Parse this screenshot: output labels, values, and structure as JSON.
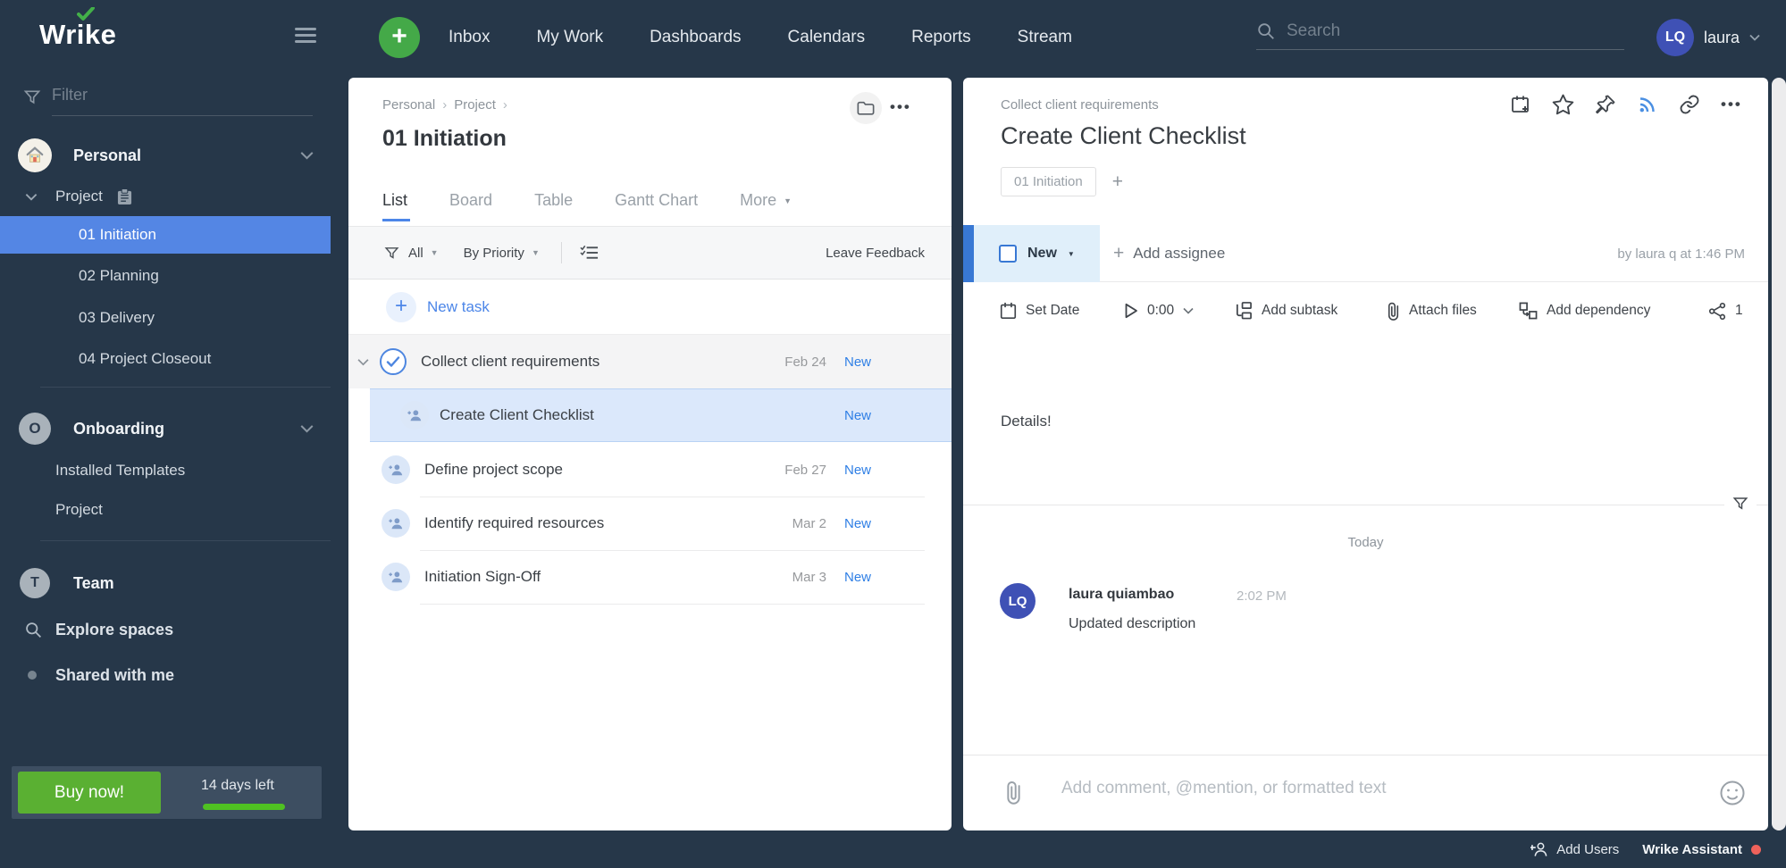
{
  "topbar": {
    "logo": "Wrike",
    "nav_items": [
      "Inbox",
      "My Work",
      "Dashboards",
      "Calendars",
      "Reports",
      "Stream"
    ],
    "search_placeholder": "Search",
    "user": {
      "initials": "LQ",
      "name": "laura"
    }
  },
  "sidebar": {
    "filter_placeholder": "Filter",
    "personal": {
      "label": "Personal"
    },
    "project_group": {
      "label": "Project",
      "items": [
        "01 Initiation",
        "02 Planning",
        "03 Delivery",
        "04 Project Closeout"
      ]
    },
    "onboarding": {
      "label": "Onboarding",
      "items": [
        "Installed Templates",
        "Project"
      ]
    },
    "team": {
      "label": "Team"
    },
    "explore": {
      "label": "Explore spaces"
    },
    "shared": {
      "label": "Shared with me"
    },
    "trial": {
      "buy_label": "Buy now!",
      "days_left": "14 days left"
    }
  },
  "list_panel": {
    "breadcrumb": {
      "first": "Personal",
      "second": "Project"
    },
    "title": "01 Initiation",
    "tabs": [
      "List",
      "Board",
      "Table",
      "Gantt Chart",
      "More"
    ],
    "filter_bar": {
      "scope": "All",
      "sort": "By Priority",
      "feedback_link": "Leave Feedback"
    },
    "new_task_label": "New task",
    "tasks": [
      {
        "title": "Collect client requirements",
        "date": "Feb 24",
        "status": "New"
      },
      {
        "title": "Create Client Checklist",
        "date": "",
        "status": "New"
      },
      {
        "title": "Define project scope",
        "date": "Feb 27",
        "status": "New"
      },
      {
        "title": "Identify required resources",
        "date": "Mar 2",
        "status": "New"
      },
      {
        "title": "Initiation Sign-Off",
        "date": "Mar 3",
        "status": "New"
      }
    ]
  },
  "task_panel": {
    "parent_task": "Collect client requirements",
    "title": "Create Client Checklist",
    "project_tag": "01 Initiation",
    "status_label": "New",
    "add_assignee_label": "Add assignee",
    "last_update": "by laura q at 1:46 PM",
    "toolbar": {
      "set_date": "Set Date",
      "time_tracker": "0:00",
      "add_subtask": "Add subtask",
      "attach_files": "Attach files",
      "add_dependency": "Add dependency",
      "share_count": "1"
    },
    "description": "Details!",
    "activity": {
      "day_label": "Today",
      "comment": {
        "initials": "LQ",
        "author": "laura quiambao",
        "time": "2:02 PM",
        "text": "Updated description"
      }
    },
    "comment_placeholder": "Add comment, @mention, or formatted text"
  },
  "statusbar": {
    "add_users": "Add Users",
    "assistant": "Wrike Assistant"
  },
  "colors": {
    "navy": "#263749",
    "accent_blue": "#4c86e8",
    "selected_blue": "#5486e4",
    "status_light_blue": "#e0effa",
    "link_blue": "#2f7fe5",
    "green": "#5ab032",
    "assistant_dot": "#ef625b"
  }
}
